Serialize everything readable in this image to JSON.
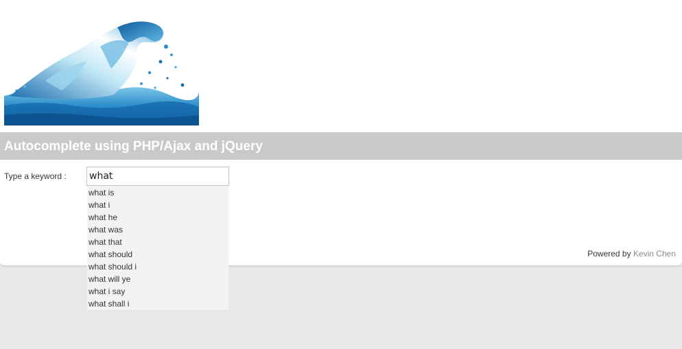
{
  "logo": {
    "icon": "water-splash-logo"
  },
  "header": {
    "title": "Autocomplete using PHP/Ajax and jQuery"
  },
  "form": {
    "label": "Type a keyword :",
    "value": "what"
  },
  "suggestions": [
    "what is",
    "what i",
    "what he",
    "what was",
    "what that",
    "what should",
    "what should i",
    "what will ye",
    "what i say",
    "what shall i"
  ],
  "footer": {
    "prefix": "Powered by",
    "author": "Kevin Chen"
  },
  "colors": {
    "title_bar_bg": "#c9c9c9",
    "title_text": "#ffffff",
    "page_bg": "#e8e8e8",
    "suggestion_bg": "#f2f2f2",
    "link": "#8a8a8a"
  }
}
